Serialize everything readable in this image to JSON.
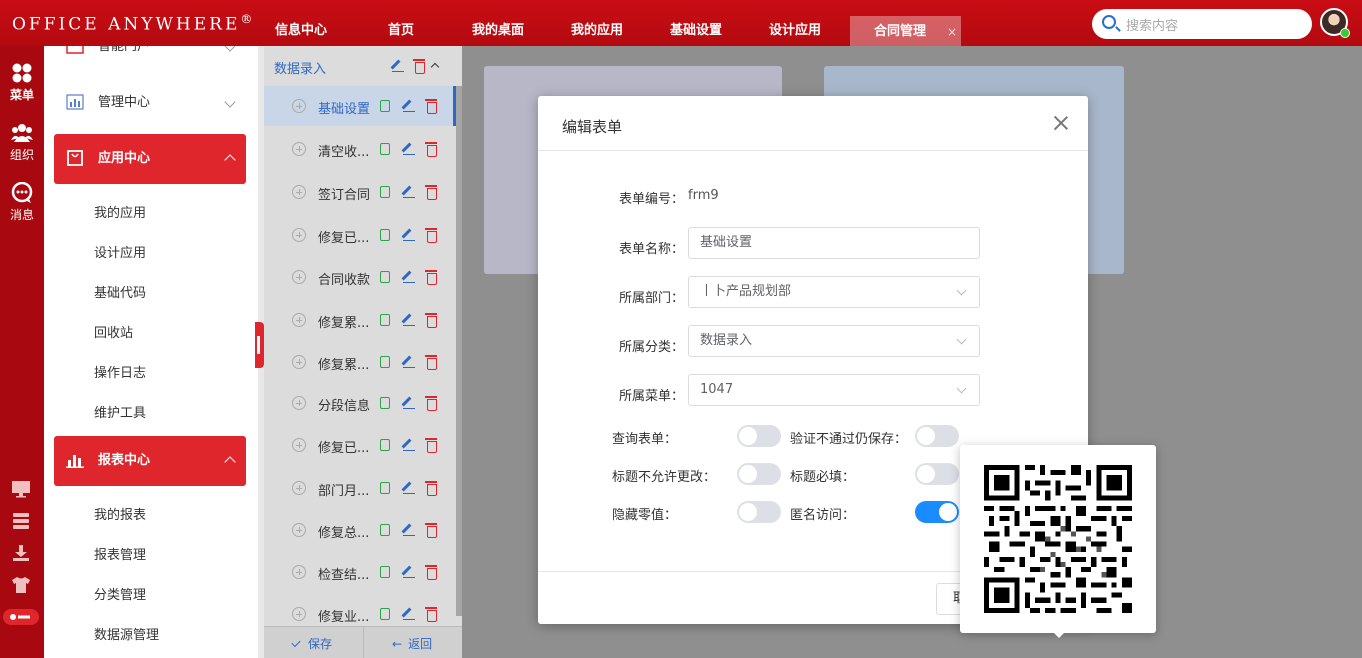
{
  "app": {
    "logo": "OFFICE ANYWHERE",
    "logo_mark": "®"
  },
  "topnav": {
    "items": [
      {
        "label": "信息中心"
      },
      {
        "label": "首页"
      },
      {
        "label": "我的桌面"
      },
      {
        "label": "我的应用"
      },
      {
        "label": "基础设置"
      },
      {
        "label": "设计应用"
      },
      {
        "label": "合同管理"
      }
    ],
    "active_close": "×",
    "search_placeholder": "搜索内容"
  },
  "leftbar": {
    "items": [
      {
        "label": "菜单"
      },
      {
        "label": "组织"
      },
      {
        "label": "消息"
      }
    ]
  },
  "menu": {
    "portal": "智能门户",
    "manage": "管理中心",
    "app_center": "应用中心",
    "app_items": [
      "我的应用",
      "设计应用",
      "基础代码",
      "回收站",
      "操作日志",
      "维护工具"
    ],
    "report_center": "报表中心",
    "report_items": [
      "我的报表",
      "报表管理",
      "分类管理",
      "数据源管理"
    ]
  },
  "formlist": {
    "category": "数据录入",
    "items": [
      "基础设置",
      "清空收...",
      "签订合同",
      "修复已...",
      "合同收款",
      "修复累...",
      "修复累...",
      "分段信息",
      "修复已...",
      "部门月...",
      "修复总...",
      "检查结...",
      "修复业..."
    ],
    "save": "保存",
    "back": "返回"
  },
  "modal": {
    "title": "编辑表单",
    "form_no_label": "表单编号：",
    "form_no": "frm9",
    "form_name_label": "表单名称：",
    "form_name": "基础设置",
    "dept_label": "所属部门：",
    "dept": "丨卜产品规划部",
    "category_label": "所属分类：",
    "category": "数据录入",
    "menu_label": "所属菜单：",
    "menu": "1047",
    "toggles": {
      "query_label": "查询表单：",
      "save_invalid_label": "验证不通过仍保存：",
      "title_locked_label": "标题不允许更改：",
      "title_required_label": "标题必填：",
      "hide_zero_label": "隐藏零值：",
      "anonymous_label": "匿名访问："
    },
    "cancel": "取消"
  },
  "colors": {
    "brand_red": "#c90d14",
    "accent_blue": "#1a8cff"
  }
}
